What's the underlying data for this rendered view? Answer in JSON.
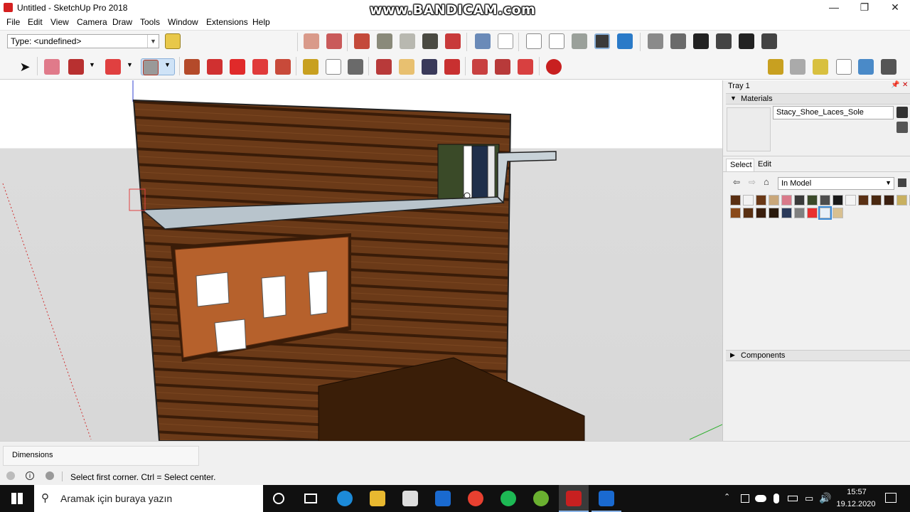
{
  "window": {
    "title": "Untitled - SketchUp Pro 2018",
    "minimize": "—",
    "maximize": "❐",
    "close": "✕"
  },
  "watermark": "www.BANDICAM.com",
  "menu": [
    "File",
    "Edit",
    "View",
    "Camera",
    "Draw",
    "Tools",
    "Window",
    "Extensions",
    "Help"
  ],
  "toolbar": {
    "type_select": "Type: <undefined>"
  },
  "tray": {
    "title": "Tray 1",
    "materials_label": "Materials",
    "material_name": "Stacy_Shoe_Laces_Sole",
    "tabs": [
      "Select",
      "Edit"
    ],
    "library_select": "In Model",
    "components_label": "Components",
    "swatches_row1": [
      "#5a2f12",
      "#f2f2f2",
      "#6a3816",
      "#c9a77a",
      "#d97a8a",
      "#3a3a3a",
      "#3b4a2a",
      "#4d4d4d",
      "#1a1a1a",
      "#f4f4f4",
      "#5a3014",
      "#4a2810",
      "#3c2010",
      "#c8b060",
      "#a08860"
    ],
    "swatches_row2": [
      "#8a4a1a",
      "#5a3012",
      "#3a1e0c",
      "#2a1a0c",
      "#2a3a5a",
      "#808080",
      "#e83030",
      "#e8f0f8",
      "#d8c090"
    ]
  },
  "status": {
    "dimensions_label": "Dimensions",
    "hint": "Select first corner. Ctrl = Select center."
  },
  "taskbar": {
    "search_placeholder": "Aramak için buraya yazın",
    "time": "15:57",
    "date": "19.12.2020"
  }
}
